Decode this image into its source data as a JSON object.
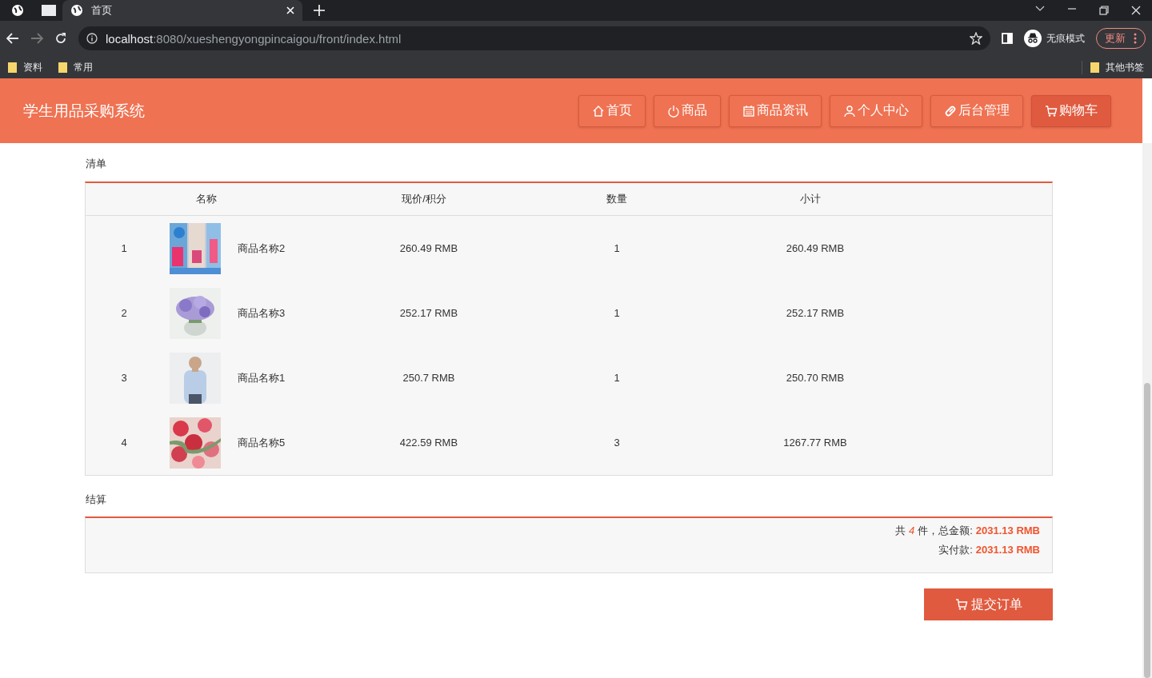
{
  "browser": {
    "tab_title": "首页",
    "url_host": "localhost",
    "url_path": ":8080/xueshengyongpincaigou/front/index.html",
    "profile": "无痕模式",
    "update_button": "更新",
    "bookmarks": [
      "资料",
      "常用"
    ],
    "other_bookmarks": "其他书签"
  },
  "header": {
    "site_title": "学生用品采购系统",
    "nav": [
      {
        "label": "首页",
        "selected": false
      },
      {
        "label": "商品",
        "selected": false
      },
      {
        "label": "商品资讯",
        "selected": false
      },
      {
        "label": "个人中心",
        "selected": false
      },
      {
        "label": "后台管理",
        "selected": false
      },
      {
        "label": "购物车",
        "selected": true
      }
    ]
  },
  "cart": {
    "section_title": "清单",
    "columns": [
      "名称",
      "现价/积分",
      "数量",
      "小计"
    ],
    "rows": [
      {
        "index": "1",
        "name": "商品名称2",
        "price": "260.49 RMB",
        "quantity": "1",
        "subtotal": "260.49 RMB"
      },
      {
        "index": "2",
        "name": "商品名称3",
        "price": "252.17 RMB",
        "quantity": "1",
        "subtotal": "252.17 RMB"
      },
      {
        "index": "3",
        "name": "商品名称1",
        "price": "250.7 RMB",
        "quantity": "1",
        "subtotal": "250.70 RMB"
      },
      {
        "index": "4",
        "name": "商品名称5",
        "price": "422.59 RMB",
        "quantity": "3",
        "subtotal": "1267.77 RMB"
      }
    ]
  },
  "checkout": {
    "section_title": "结算",
    "count_prefix": "共",
    "count": "4",
    "count_suffix": "件，总金额:",
    "total": "2031.13 RMB",
    "paid_label": "实付款:",
    "paid": "2031.13 RMB",
    "submit_button": "提交订单"
  }
}
